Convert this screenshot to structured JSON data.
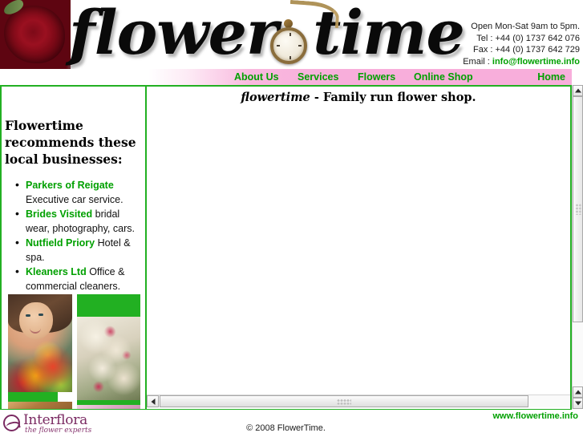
{
  "header": {
    "logo_text_left": "flower",
    "logo_text_right": "time",
    "watch_icon": "pocket-watch-icon",
    "rose_icon": "red-rose-photo",
    "contact": {
      "hours": "Open Mon-Sat 9am to 5pm.",
      "tel": "Tel : +44 (0) 1737 642 076",
      "fax": "Fax : +44 (0) 1737 642 729",
      "email_label": "Email : ",
      "email_value": "info@flowertime.info"
    }
  },
  "nav": {
    "about": "About Us",
    "services": "Services",
    "flowers": "Flowers",
    "shop": "Online Shop",
    "home": "Home"
  },
  "sidebar": {
    "heading": "Flowertime recommends these local businesses:",
    "businesses": [
      {
        "name": "Parkers of Reigate",
        "desc": " Executive car service."
      },
      {
        "name": "Brides Visited",
        "desc": " bridal wear, photography, cars."
      },
      {
        "name": "Nutfield Priory",
        "desc": " Hotel & spa."
      },
      {
        "name": "Kleaners Ltd",
        "desc": " Office & commercial cleaners."
      }
    ],
    "photos": [
      {
        "name": "bride-with-bouquet-photo"
      },
      {
        "name": "white-orchids-photo"
      }
    ]
  },
  "main": {
    "tagline_brand": "flowertime",
    "tagline_rest": " - Family run flower shop."
  },
  "footer": {
    "interflora_name": "Interflora",
    "interflora_tagline": "the flower experts",
    "copyright": "© 2008 FlowerTime.",
    "site_url": "www.flowertime.info"
  },
  "colors": {
    "green": "#00A000",
    "border_green": "#22b022",
    "nav_pink": "#f8aedb",
    "interflora_purple": "#7a2a62"
  }
}
